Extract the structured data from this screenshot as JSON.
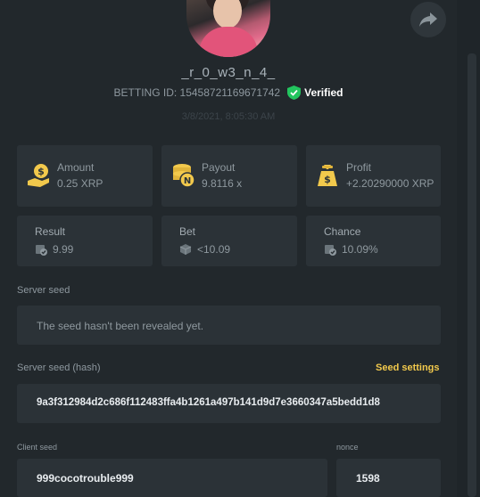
{
  "user": {
    "username": "_r_0_w3_n_4_",
    "bet_id": "BETTING ID: 15458721169671742",
    "verified_label": "Verified",
    "datetime": "3/8/2021, 8:05:30 AM"
  },
  "stats": {
    "amount": {
      "label": "Amount",
      "value": "0.25 XRP"
    },
    "payout": {
      "label": "Payout",
      "value": "9.8116 x"
    },
    "profit": {
      "label": "Profit",
      "value": "+2.20290000 XRP"
    }
  },
  "results": {
    "result": {
      "label": "Result",
      "value": "9.99"
    },
    "bet": {
      "label": "Bet",
      "value": "<10.09"
    },
    "chance": {
      "label": "Chance",
      "value": "10.09%"
    }
  },
  "server_seed": {
    "label": "Server seed",
    "value": "The seed hasn't been revealed yet."
  },
  "server_seed_hash": {
    "label": "Server seed (hash)",
    "settings_link": "Seed settings",
    "value": "9a3f312984d2c686f112483ffa4b1261a497b141d9d7e3660347a5bedd1d8"
  },
  "client_seed": {
    "label": "Client seed",
    "value": "999cocotrouble999"
  },
  "nonce": {
    "label": "nonce",
    "value": "1598"
  },
  "colors": {
    "background": "#22282c",
    "card": "#2b3237",
    "accent_yellow": "#f2c94c",
    "verified_green": "#22c55e"
  }
}
